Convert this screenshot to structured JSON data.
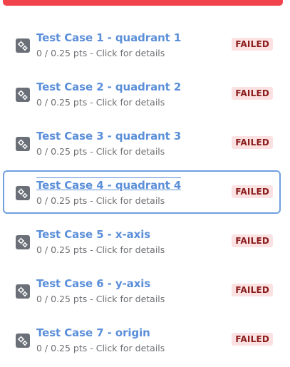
{
  "colors": {
    "top_bar": "#f0434b",
    "title": "#5b8fd9",
    "subtitle": "#6d6f73",
    "badge_bg": "#fbe1e1",
    "badge_text": "#8a1c1c",
    "focus_border": "#6f9fe0",
    "icon_bg": "#6b7078"
  },
  "icon_name": "gears-icon",
  "test_cases": [
    {
      "title": "Test Case 1 - quadrant 1",
      "subtitle": "0 / 0.25 pts - Click for details",
      "status": "FAILED"
    },
    {
      "title": "Test Case 2 - quadrant 2",
      "subtitle": "0 / 0.25 pts - Click for details",
      "status": "FAILED"
    },
    {
      "title": "Test Case 3 - quadrant 3",
      "subtitle": "0 / 0.25 pts - Click for details",
      "status": "FAILED"
    },
    {
      "title": "Test Case 4 - quadrant 4",
      "subtitle": "0 / 0.25 pts - Click for details",
      "status": "FAILED"
    },
    {
      "title": "Test Case 5 - x-axis",
      "subtitle": "0 / 0.25 pts - Click for details",
      "status": "FAILED"
    },
    {
      "title": "Test Case 6 - y-axis",
      "subtitle": "0 / 0.25 pts - Click for details",
      "status": "FAILED"
    },
    {
      "title": "Test Case 7 - origin",
      "subtitle": "0 / 0.25 pts - Click for details",
      "status": "FAILED"
    }
  ]
}
